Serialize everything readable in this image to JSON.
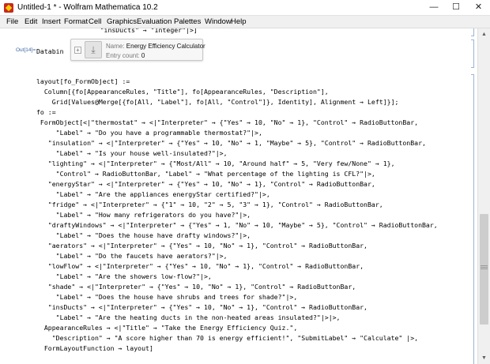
{
  "window": {
    "title": "Untitled-1 * - Wolfram Mathematica 10.2",
    "min_symbol": "—",
    "max_symbol": "☐",
    "close_symbol": "✕"
  },
  "menu": {
    "items": [
      "File",
      "Edit",
      "Insert",
      "Format",
      "Cell",
      "Graphics",
      "Evaluation",
      "Palettes",
      "Window",
      "Help"
    ]
  },
  "scrollbar": {
    "up": "▲",
    "down": "▼"
  },
  "output": {
    "label": "Out[14]=",
    "prefix": "Databin",
    "entity": {
      "name_label": "Name:",
      "name_value": "Energy Efficiency Calculator",
      "count_label": "Entry count:",
      "count_value": "0"
    }
  },
  "code_lines": [
    "                    \"insDucts\" → \"Integer\"|>]",
    "layout[fo_FormObject] :=",
    "  Column[{fo[AppearanceRules, \"Title\"], fo[AppearanceRules, \"Description\"],",
    "    Grid[Values@Merge[{fo[All, \"Label\"], fo[All, \"Control\"]}, Identity], Alignment → Left]}];",
    "fo :=",
    " FormObject[<|\"thermostat\" → <|\"Interpreter\" → {\"Yes\" → 10, \"No\" → 1}, \"Control\" → RadioButtonBar,",
    "     \"Label\" → \"Do you have a programmable thermostat?\"|>,",
    "   \"insulation\" → <|\"Interpreter\" → {\"Yes\" → 10, \"No\" → 1, \"Maybe\" → 5}, \"Control\" → RadioButtonBar,",
    "     \"Label\" → \"Is your house well-insulated?\"|>,",
    "   \"lighting\" → <|\"Interpreter\" → {\"Most/All\" → 10, \"Around half\" → 5, \"Very few/None\" → 1},",
    "     \"Control\" → RadioButtonBar, \"Label\" → \"What percentage of the lighting is CFL?\"|>,",
    "   \"energyStar\" → <|\"Interpreter\" → {\"Yes\" → 10, \"No\" → 1}, \"Control\" → RadioButtonBar,",
    "     \"Label\" → \"Are the appliances energyStar certified?\"|>,",
    "   \"fridge\" → <|\"Interpreter\" → {\"1\" → 10, \"2\" → 5, \"3\" → 1}, \"Control\" → RadioButtonBar,",
    "     \"Label\" → \"How many refrigerators do you have?\"|>,",
    "   \"draftyWindows\" → <|\"Interpreter\" → {\"Yes\" → 1, \"No\" → 10, \"Maybe\" → 5}, \"Control\" → RadioButtonBar,",
    "     \"Label\" → \"Does the house have drafty windows?\"|>,",
    "   \"aerators\" → <|\"Interpreter\" → {\"Yes\" → 10, \"No\" → 1}, \"Control\" → RadioButtonBar,",
    "     \"Label\" → \"Do the faucets have aerators?\"|>,",
    "   \"lowFlow\" → <|\"Interpreter\" → {\"Yes\" → 10, \"No\" → 1}, \"Control\" → RadioButtonBar,",
    "     \"Label\" → \"Are the showers low-flow?\"|>,",
    "   \"shade\" → <|\"Interpreter\" → {\"Yes\" → 10, \"No\" → 1}, \"Control\" → RadioButtonBar,",
    "     \"Label\" → \"Does the house have shrubs and trees for shade?\"|>,",
    "   \"insDucts\" → <|\"Interpreter\" → {\"Yes\" → 10, \"No\" → 1}, \"Control\" → RadioButtonBar,",
    "     \"Label\" → \"Are the heating ducts in the non-heated areas insulated?\"|>|>,",
    "  AppearanceRules → <|\"Title\" → \"Take the Energy Efficiency Quiz.\",",
    "    \"Description\" → \"A score higher than 70 is energy efficient!\", \"SubmitLabel\" → \"Calculate\" |>,",
    "  FormLayoutFunction → layout]"
  ]
}
